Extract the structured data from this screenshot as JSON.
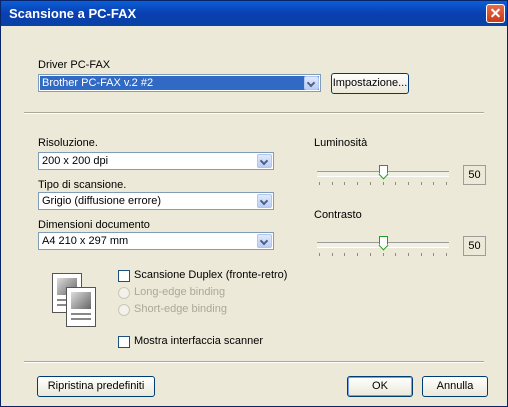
{
  "window": {
    "title": "Scansione a PC-FAX"
  },
  "driver": {
    "label": "Driver PC-FAX",
    "selected": "Brother PC-FAX v.2 #2",
    "settings_button": "Impostazione..."
  },
  "resolution": {
    "label": "Risoluzione.",
    "selected": "200 x 200 dpi"
  },
  "scan_type": {
    "label": "Tipo di scansione.",
    "selected": "Grigio (diffusione errore)"
  },
  "doc_size": {
    "label": "Dimensioni documento",
    "selected": "A4 210 x 297 mm"
  },
  "brightness": {
    "label": "Luminosità",
    "value": 50,
    "min": 0,
    "max": 100
  },
  "contrast": {
    "label": "Contrasto",
    "value": 50,
    "min": 0,
    "max": 100
  },
  "duplex": {
    "checkbox_label": "Scansione Duplex (fronte-retro)",
    "checked": false,
    "long_edge_label": "Long-edge binding",
    "short_edge_label": "Short-edge binding"
  },
  "show_scanner_interface": {
    "label": "Mostra interfaccia scanner",
    "checked": false
  },
  "buttons": {
    "restore_defaults": "Ripristina predefiniti",
    "ok": "OK",
    "cancel": "Annulla"
  }
}
